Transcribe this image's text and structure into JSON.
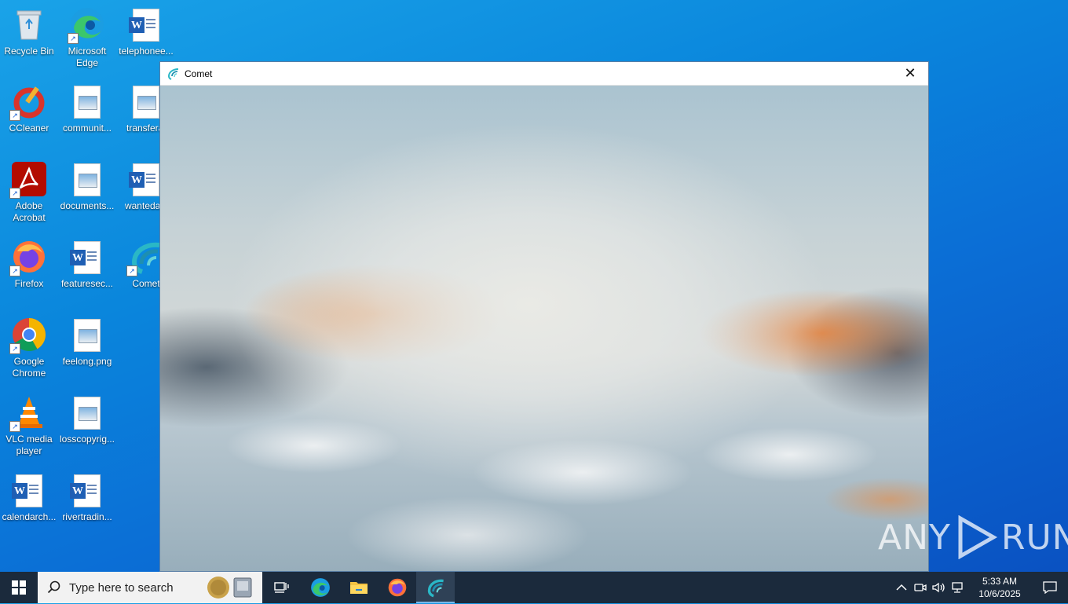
{
  "desktop": {
    "icons": [
      {
        "label": "Recycle Bin"
      },
      {
        "label": "Microsoft Edge"
      },
      {
        "label": "telephonee..."
      },
      {
        "label": "CCleaner"
      },
      {
        "label": "communit..."
      },
      {
        "label": "transferal"
      },
      {
        "label": "Adobe Acrobat"
      },
      {
        "label": "documents..."
      },
      {
        "label": "wantedals"
      },
      {
        "label": "Firefox"
      },
      {
        "label": "featuresec..."
      },
      {
        "label": "Comet"
      },
      {
        "label": "Google Chrome"
      },
      {
        "label": "feelong.png"
      },
      {
        "label": "VLC media player"
      },
      {
        "label": "losscopyrig..."
      },
      {
        "label": "calendarch..."
      },
      {
        "label": "rivertradin..."
      }
    ]
  },
  "window": {
    "title": "Comet",
    "close_glyph": "✕"
  },
  "watermark": {
    "text_left": "ANY",
    "text_right": "RUN"
  },
  "taskbar": {
    "search_placeholder": "Type here to search",
    "pinned": [
      "task-view",
      "edge",
      "file-explorer",
      "firefox",
      "comet"
    ],
    "active": "comet"
  },
  "tray": {
    "time": "5:33 AM",
    "date": "10/6/2025"
  },
  "colors": {
    "accent": "#0b78d7",
    "taskbar": "#1b2a3c",
    "comet_teal": "#2ab7c6"
  }
}
